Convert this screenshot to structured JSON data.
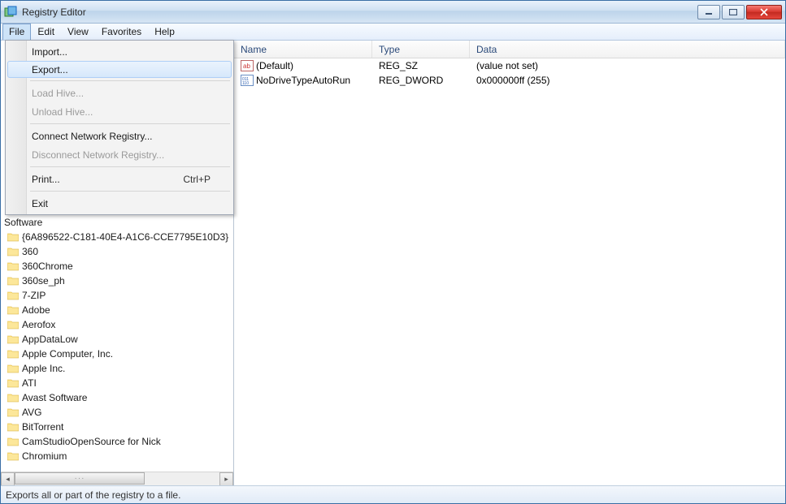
{
  "window": {
    "title": "Registry Editor"
  },
  "menubar": [
    "File",
    "Edit",
    "View",
    "Favorites",
    "Help"
  ],
  "file_menu": {
    "import": "Import...",
    "export": "Export...",
    "load_hive": "Load Hive...",
    "unload_hive": "Unload Hive...",
    "connect": "Connect Network Registry...",
    "disconnect": "Disconnect Network Registry...",
    "print": "Print...",
    "print_shortcut": "Ctrl+P",
    "exit": "Exit"
  },
  "tree": {
    "parent": "Software",
    "children": [
      "{6A896522-C181-40E4-A1C6-CCE7795E10D3}",
      "360",
      "360Chrome",
      "360se_ph",
      "7-ZIP",
      "Adobe",
      "Aerofox",
      "AppDataLow",
      "Apple Computer, Inc.",
      "Apple Inc.",
      "ATI",
      "Avast Software",
      "AVG",
      "BitTorrent",
      "CamStudioOpenSource for Nick",
      "Chromium"
    ]
  },
  "list": {
    "headers": {
      "name": "Name",
      "type": "Type",
      "data": "Data"
    },
    "rows": [
      {
        "icon": "sz",
        "name": "(Default)",
        "type": "REG_SZ",
        "data": "(value not set)"
      },
      {
        "icon": "dw",
        "name": "NoDriveTypeAutoRun",
        "type": "REG_DWORD",
        "data": "0x000000ff (255)"
      }
    ]
  },
  "statusbar": "Exports all or part of the registry to a file."
}
